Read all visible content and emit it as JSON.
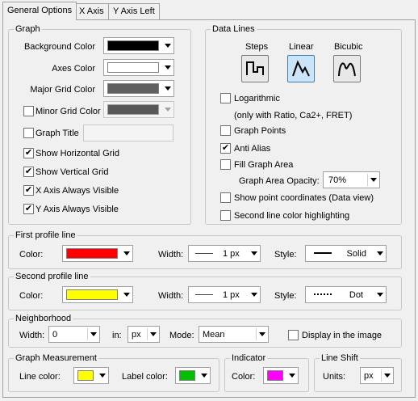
{
  "tabs": [
    {
      "label": "General Options"
    },
    {
      "label": "X Axis"
    },
    {
      "label": "Y Axis Left"
    }
  ],
  "graph": {
    "title": "Graph",
    "background_color": {
      "label": "Background Color",
      "color": "#000000"
    },
    "axes_color": {
      "label": "Axes Color",
      "color": "#ffffff"
    },
    "major_grid_color": {
      "label": "Major Grid Color",
      "color": "#606060"
    },
    "minor_grid_color": {
      "label": "Minor Grid Color",
      "color": "#585858",
      "checked": false
    },
    "graph_title": {
      "label": "Graph Title",
      "checked": false,
      "value": ""
    },
    "show_horizontal_grid": {
      "label": "Show Horizontal Grid",
      "checked": true
    },
    "show_vertical_grid": {
      "label": "Show Vertical Grid",
      "checked": true
    },
    "x_axis_always_visible": {
      "label": "X Axis Always Visible",
      "checked": true
    },
    "y_axis_always_visible": {
      "label": "Y Axis Always Visible",
      "checked": true
    }
  },
  "data_lines": {
    "title": "Data Lines",
    "modes": [
      {
        "label": "Steps",
        "icon": "steps-icon",
        "pressed": false
      },
      {
        "label": "Linear",
        "icon": "linear-icon",
        "pressed": true
      },
      {
        "label": "Bicubic",
        "icon": "bicubic-icon",
        "pressed": false
      }
    ],
    "logarithmic": {
      "label": "Logarithmic",
      "checked": false
    },
    "logarithmic_note": "(only with Ratio, Ca2+, FRET)",
    "graph_points": {
      "label": "Graph Points",
      "checked": false
    },
    "anti_alias": {
      "label": "Anti Alias",
      "checked": true
    },
    "fill_graph_area": {
      "label": "Fill Graph Area",
      "checked": false
    },
    "graph_area_opacity": {
      "label": "Graph Area Opacity:",
      "value": "70%"
    },
    "show_point_coordinates": {
      "label": "Show point coordinates (Data view)",
      "checked": false
    },
    "second_line_color_highlighting": {
      "label": "Second line color highlighting",
      "checked": false
    }
  },
  "first_profile_line": {
    "title": "First profile line",
    "color_label": "Color:",
    "color": "#ff0000",
    "width_label": "Width:",
    "width_value": "1 px",
    "style_label": "Style:",
    "style_value": "Solid"
  },
  "second_profile_line": {
    "title": "Second profile line",
    "color_label": "Color:",
    "color": "#ffff00",
    "width_label": "Width:",
    "width_value": "1 px",
    "style_label": "Style:",
    "style_value": "Dot"
  },
  "neighborhood": {
    "title": "Neighborhood",
    "width_label": "Width:",
    "width_value": "0",
    "in_label": "in:",
    "in_value": "px",
    "mode_label": "Mode:",
    "mode_value": "Mean",
    "display_in_image": {
      "label": "Display in the image",
      "checked": false
    }
  },
  "graph_measurement": {
    "title": "Graph Measurement",
    "line_color_label": "Line color:",
    "line_color": "#ffff00",
    "label_color_label": "Label color:",
    "label_color": "#00c000"
  },
  "indicator": {
    "title": "Indicator",
    "color_label": "Color:",
    "color": "#ff00ff"
  },
  "line_shift": {
    "title": "Line Shift",
    "units_label": "Units:",
    "units_value": "px"
  }
}
